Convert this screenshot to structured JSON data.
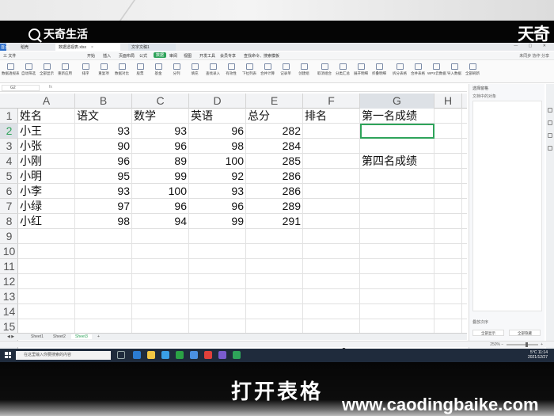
{
  "overlay": {
    "logo_left": "天奇生活",
    "logo_right": "天奇",
    "subtitle": "打开表格",
    "watermark": "www.caodingbaike.com"
  },
  "window": {
    "tabs": [
      "首页",
      "稻壳",
      "数据透视表.xlsx",
      "文字文稿1"
    ],
    "active_tab": "数据透视表.xlsx"
  },
  "menu": {
    "items": [
      "三 文件",
      "开始",
      "插入",
      "页面布局",
      "公式",
      "数据",
      "审阅",
      "视图",
      "开发工具",
      "会员专享",
      "查找命令、搜索模板"
    ],
    "active": "数据",
    "right": "未同步  协作  分享"
  },
  "ribbon": {
    "buttons": [
      "数据透视表",
      "自动筛选",
      "全部显示",
      "重新应用",
      "排序",
      "重复项",
      "数据对比",
      "股票",
      "基金",
      "分列",
      "填充",
      "查找录入",
      "有效性",
      "下拉列表",
      "合并计算",
      "记录单",
      "创建组",
      "取消组合",
      "分类汇总",
      "展开明细",
      "折叠明细",
      "拆分表格",
      "合并表格",
      "WPS云数据",
      "导入数据",
      "全部刷新"
    ]
  },
  "formula_bar": {
    "name_box": "G2",
    "fx": "fx",
    "value": ""
  },
  "sheet": {
    "columns": [
      "A",
      "B",
      "C",
      "D",
      "E",
      "F",
      "G",
      "H"
    ],
    "selected_column": "G",
    "row_numbers": [
      "1",
      "2",
      "3",
      "4",
      "5",
      "6",
      "7",
      "8",
      "9",
      "10",
      "11",
      "12",
      "13",
      "14",
      "15"
    ],
    "selected_row": "2",
    "header": [
      "姓名",
      "语文",
      "数学",
      "英语",
      "总分",
      "排名",
      "第一名成绩"
    ],
    "rows": [
      [
        "小王",
        "93",
        "93",
        "96",
        "282"
      ],
      [
        "小张",
        "90",
        "96",
        "98",
        "284"
      ],
      [
        "小刚",
        "96",
        "89",
        "100",
        "285"
      ],
      [
        "小明",
        "95",
        "99",
        "92",
        "286"
      ],
      [
        "小李",
        "93",
        "100",
        "93",
        "286"
      ],
      [
        "小绿",
        "97",
        "96",
        "96",
        "289"
      ],
      [
        "小红",
        "98",
        "94",
        "99",
        "291"
      ]
    ],
    "g4_label": "第四名成绩",
    "tabs": [
      "Sheet1",
      "Sheet2",
      "Sheet3"
    ],
    "active_tab": "Sheet3"
  },
  "right_pane": {
    "title": "选择窗格",
    "subtitle": "文档中的对象",
    "footer": "叠放次序",
    "show_all": "全部显示",
    "hide_all": "全部隐藏"
  },
  "status": {
    "zoom": "250%"
  },
  "taskbar": {
    "search_placeholder": "在这里输入你要搜索的内容",
    "weather": "5°C",
    "time": "11:14",
    "date": "2021/12/27"
  },
  "colors": {
    "accent_green": "#2ea35a",
    "taskbar": "#1f2b3c"
  }
}
